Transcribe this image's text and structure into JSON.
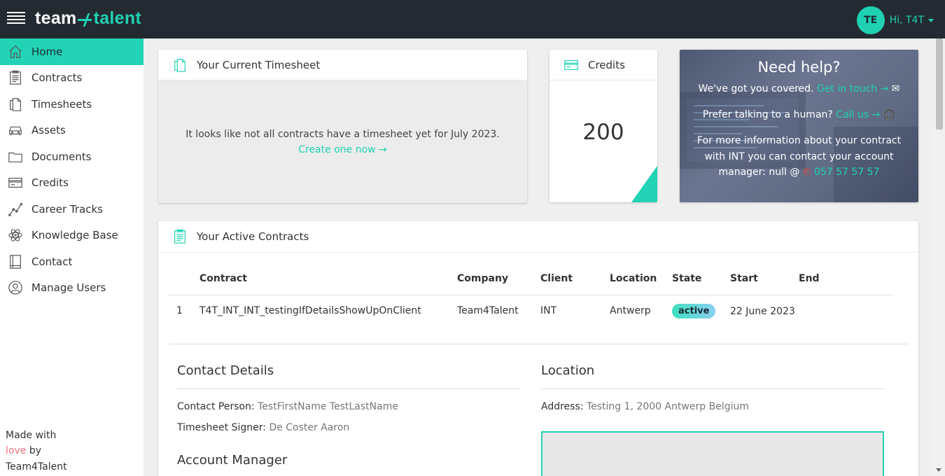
{
  "app": {
    "logo_left": "team",
    "logo_right": "talent",
    "user_initials": "TE",
    "user_greeting": "Hi, T4T",
    "accent_color": "#22d3b5"
  },
  "sidebar": {
    "items": [
      {
        "label": "Home",
        "icon": "home-icon"
      },
      {
        "label": "Contracts",
        "icon": "contracts-icon"
      },
      {
        "label": "Timesheets",
        "icon": "timesheets-icon"
      },
      {
        "label": "Assets",
        "icon": "car-icon"
      },
      {
        "label": "Documents",
        "icon": "folder-icon"
      },
      {
        "label": "Credits",
        "icon": "credit-card-icon"
      },
      {
        "label": "Career Tracks",
        "icon": "chart-line-icon"
      },
      {
        "label": "Knowledge Base",
        "icon": "atom-icon"
      },
      {
        "label": "Contact",
        "icon": "contact-book-icon"
      },
      {
        "label": "Manage Users",
        "icon": "user-icon"
      }
    ],
    "footer": {
      "made_with": "Made with",
      "love": "love",
      "by": "by",
      "company": "Team4Talent"
    }
  },
  "timesheet": {
    "title": "Your Current Timesheet",
    "message": "It looks like not all contracts have a timesheet yet for July 2023.",
    "link": "Create one now →"
  },
  "credits": {
    "title": "Credits",
    "value": "200"
  },
  "help": {
    "title": "Need help?",
    "line1_text": "We've got you covered.",
    "line1_link": "Get in touch →",
    "line2_text": "Prefer talking to a human?",
    "line2_link": "Call us →",
    "line3_text": "For more information about your contract with INT you can contact your account manager: null @",
    "line3_phone": "057 57 57 57"
  },
  "contracts": {
    "title": "Your Active Contracts",
    "columns": [
      "",
      "Contract",
      "Company",
      "Client",
      "Location",
      "State",
      "Start",
      "End"
    ],
    "rows": [
      {
        "index": "1",
        "contract": "T4T_INT_INT_testingIfDetailsShowUpOnClient",
        "company": "Team4Talent",
        "client": "INT",
        "location": "Antwerp",
        "state": "active",
        "start": "22 June 2023",
        "end": ""
      }
    ],
    "contact_details": {
      "title": "Contact Details",
      "contact_person_label": "Contact Person:",
      "contact_person_value": "TestFirstName TestLastName",
      "signer_label": "Timesheet Signer:",
      "signer_value": "De Coster Aaron"
    },
    "account_manager": {
      "title": "Account Manager"
    },
    "location": {
      "title": "Location",
      "address_label": "Address:",
      "address_value": "Testing 1, 2000 Antwerp Belgium"
    }
  }
}
